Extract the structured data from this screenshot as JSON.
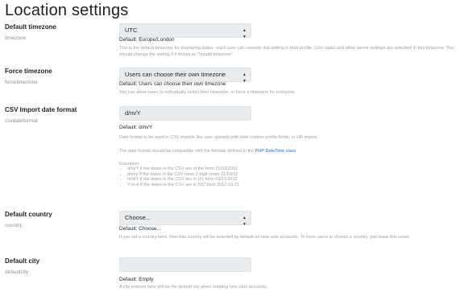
{
  "page_title": "Location settings",
  "settings": [
    {
      "label": "Default timezone",
      "key": "timezone",
      "control_value": "UTC",
      "default": "Default: Europe/London",
      "description": "This is the default timezone for displaying dates - each user can override this setting in their profile. Cron tasks and other server settings are specified in this timezone. You should change the setting if it shows as \"Invalid timezone\""
    },
    {
      "label": "Force timezone",
      "key": "forcetimezone",
      "control_value": "Users can choose their own timezone",
      "default": "Default: Users can choose their own timezone",
      "description": "You can allow users to individually select their timezone, or force a timezone for everyone."
    },
    {
      "label": "CSV Import date format",
      "key": "csvdateformat",
      "control_value": "d/m/Y",
      "default": "Default: d/m/Y",
      "description": "Date format to be used in CSV imports like user uploads with date custom profile fields, or HR import.",
      "description2_prefix": "The date format should be compatible with the formats defined in the ",
      "description2_link": "PHP DateTime class",
      "examples_heading": "Examples:",
      "examples": [
        "d/m/Y if the dates in the CSV are of the form 21/03/2012",
        "d/m/y if the dates in the CSV have 2-digit years 21/03/12",
        "m/d/Y if the dates in the CSV are in US form 03/21/2012",
        "Y-m-d if the dates in the CSV are in ISO form 2012-03-21"
      ]
    },
    {
      "label": "Default country",
      "key": "country",
      "control_value": "Choose...",
      "default": "Default: Choose...",
      "description": "If you set a country here, then this country will be selected by default on new user accounts. To force users to choose a country, just leave this unset."
    },
    {
      "label": "Default city",
      "key": "defaultcity",
      "control_value": "",
      "default": "Default: Empty",
      "description": "A city entered here will be the default city when creating new user accounts."
    }
  ],
  "colors": {
    "link": "#0f6cbf",
    "control_bg": "#e9ecef",
    "muted": "#8a9199"
  },
  "icons": {
    "select_arrow": "up-down-caret-icon"
  }
}
